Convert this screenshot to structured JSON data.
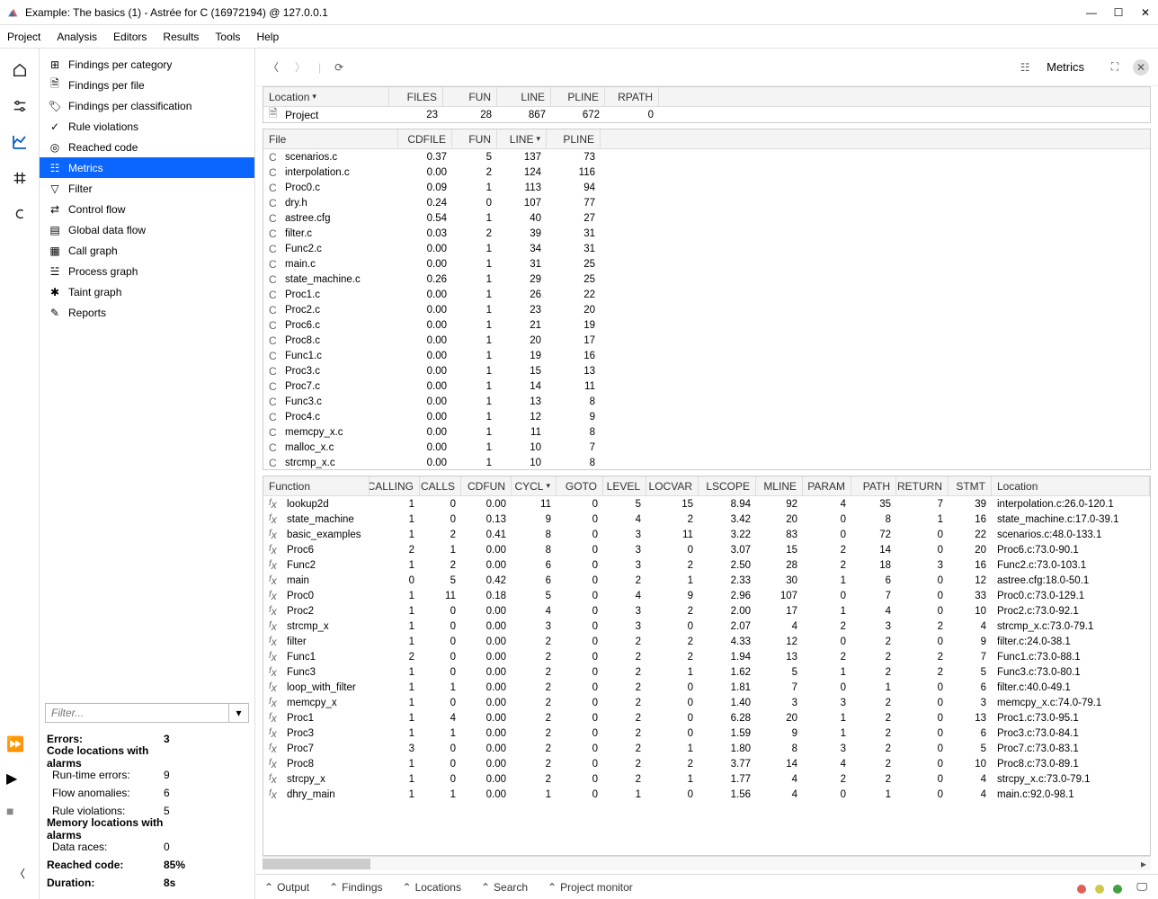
{
  "window": {
    "title": "Example: The basics (1) - Astrée for C (16972194) @ 127.0.0.1"
  },
  "menu": [
    "Project",
    "Analysis",
    "Editors",
    "Results",
    "Tools",
    "Help"
  ],
  "nav": {
    "items": [
      {
        "label": "Findings per category",
        "icon": "⊞"
      },
      {
        "label": "Findings per file",
        "icon": "🗎"
      },
      {
        "label": "Findings per classification",
        "icon": "🏷"
      },
      {
        "label": "Rule violations",
        "icon": "✓"
      },
      {
        "label": "Reached code",
        "icon": "◎"
      },
      {
        "label": "Metrics",
        "icon": "☷",
        "selected": true
      },
      {
        "label": "Filter",
        "icon": "▽"
      },
      {
        "label": "Control flow",
        "icon": "⇄"
      },
      {
        "label": "Global data flow",
        "icon": "▤"
      },
      {
        "label": "Call graph",
        "icon": "▦"
      },
      {
        "label": "Process graph",
        "icon": "☱"
      },
      {
        "label": "Taint graph",
        "icon": "✱"
      },
      {
        "label": "Reports",
        "icon": "✎"
      }
    ],
    "filter_placeholder": "Filter..."
  },
  "summary": {
    "rows": [
      {
        "label": "Errors:",
        "value": "3",
        "bold": true
      },
      {
        "label": "Code locations with alarms",
        "value": "",
        "bold": true
      },
      {
        "label": "Run-time errors:",
        "value": "9",
        "indent": true
      },
      {
        "label": "Flow anomalies:",
        "value": "6",
        "indent": true
      },
      {
        "label": "Rule violations:",
        "value": "5",
        "indent": true
      },
      {
        "label": "Memory locations with alarms",
        "value": "",
        "bold": true
      },
      {
        "label": "Data races:",
        "value": "0",
        "indent": true
      },
      {
        "label": "Reached code:",
        "value": "85%",
        "bold": true
      },
      {
        "label": "Duration:",
        "value": "8s",
        "bold": true
      }
    ]
  },
  "toolbar_right": {
    "metrics": "Metrics"
  },
  "project_table": {
    "headers": [
      "Location",
      "FILES",
      "FUN",
      "LINE",
      "PLINE",
      "RPATH"
    ],
    "rows": [
      {
        "loc": "Project",
        "files": "23",
        "fun": "28",
        "line": "867",
        "pline": "672",
        "rpath": "0"
      }
    ]
  },
  "files_table": {
    "headers": [
      "File",
      "CDFILE",
      "FUN",
      "LINE",
      "PLINE"
    ],
    "sort_col": "LINE",
    "rows": [
      {
        "f": "scenarios.c",
        "cd": "0.37",
        "fun": "5",
        "line": "137",
        "pl": "73"
      },
      {
        "f": "interpolation.c",
        "cd": "0.00",
        "fun": "2",
        "line": "124",
        "pl": "116"
      },
      {
        "f": "Proc0.c",
        "cd": "0.09",
        "fun": "1",
        "line": "113",
        "pl": "94"
      },
      {
        "f": "dry.h",
        "cd": "0.24",
        "fun": "0",
        "line": "107",
        "pl": "77"
      },
      {
        "f": "astree.cfg",
        "cd": "0.54",
        "fun": "1",
        "line": "40",
        "pl": "27"
      },
      {
        "f": "filter.c",
        "cd": "0.03",
        "fun": "2",
        "line": "39",
        "pl": "31"
      },
      {
        "f": "Func2.c",
        "cd": "0.00",
        "fun": "1",
        "line": "34",
        "pl": "31"
      },
      {
        "f": "main.c",
        "cd": "0.00",
        "fun": "1",
        "line": "31",
        "pl": "25"
      },
      {
        "f": "state_machine.c",
        "cd": "0.26",
        "fun": "1",
        "line": "29",
        "pl": "25"
      },
      {
        "f": "Proc1.c",
        "cd": "0.00",
        "fun": "1",
        "line": "26",
        "pl": "22"
      },
      {
        "f": "Proc2.c",
        "cd": "0.00",
        "fun": "1",
        "line": "23",
        "pl": "20"
      },
      {
        "f": "Proc6.c",
        "cd": "0.00",
        "fun": "1",
        "line": "21",
        "pl": "19"
      },
      {
        "f": "Proc8.c",
        "cd": "0.00",
        "fun": "1",
        "line": "20",
        "pl": "17"
      },
      {
        "f": "Func1.c",
        "cd": "0.00",
        "fun": "1",
        "line": "19",
        "pl": "16"
      },
      {
        "f": "Proc3.c",
        "cd": "0.00",
        "fun": "1",
        "line": "15",
        "pl": "13"
      },
      {
        "f": "Proc7.c",
        "cd": "0.00",
        "fun": "1",
        "line": "14",
        "pl": "11"
      },
      {
        "f": "Func3.c",
        "cd": "0.00",
        "fun": "1",
        "line": "13",
        "pl": "8"
      },
      {
        "f": "Proc4.c",
        "cd": "0.00",
        "fun": "1",
        "line": "12",
        "pl": "9"
      },
      {
        "f": "memcpy_x.c",
        "cd": "0.00",
        "fun": "1",
        "line": "11",
        "pl": "8"
      },
      {
        "f": "malloc_x.c",
        "cd": "0.00",
        "fun": "1",
        "line": "10",
        "pl": "7"
      },
      {
        "f": "strcmp_x.c",
        "cd": "0.00",
        "fun": "1",
        "line": "10",
        "pl": "8"
      }
    ]
  },
  "functions_table": {
    "headers": [
      "Function",
      "CALLING",
      "CALLS",
      "CDFUN",
      "CYCL",
      "GOTO",
      "LEVEL",
      "LOCVAR",
      "LSCOPE",
      "MLINE",
      "PARAM",
      "PATH",
      "RETURN",
      "STMT",
      "Location"
    ],
    "sort_col": "CYCL",
    "rows": [
      {
        "fn": "lookup2d",
        "calling": "1",
        "calls": "0",
        "cd": "0.00",
        "cy": "11",
        "go": "0",
        "lv": "5",
        "lvar": "15",
        "ls": "8.94",
        "ml": "92",
        "pa": "4",
        "pt": "35",
        "re": "7",
        "st": "39",
        "loc": "interpolation.c:26.0-120.1"
      },
      {
        "fn": "state_machine",
        "calling": "1",
        "calls": "0",
        "cd": "0.13",
        "cy": "9",
        "go": "0",
        "lv": "4",
        "lvar": "2",
        "ls": "3.42",
        "ml": "20",
        "pa": "0",
        "pt": "8",
        "re": "1",
        "st": "16",
        "loc": "state_machine.c:17.0-39.1"
      },
      {
        "fn": "basic_examples",
        "calling": "1",
        "calls": "2",
        "cd": "0.41",
        "cy": "8",
        "go": "0",
        "lv": "3",
        "lvar": "11",
        "ls": "3.22",
        "ml": "83",
        "pa": "0",
        "pt": "72",
        "re": "0",
        "st": "22",
        "loc": "scenarios.c:48.0-133.1"
      },
      {
        "fn": "Proc6",
        "calling": "2",
        "calls": "1",
        "cd": "0.00",
        "cy": "8",
        "go": "0",
        "lv": "3",
        "lvar": "0",
        "ls": "3.07",
        "ml": "15",
        "pa": "2",
        "pt": "14",
        "re": "0",
        "st": "20",
        "loc": "Proc6.c:73.0-90.1"
      },
      {
        "fn": "Func2",
        "calling": "1",
        "calls": "2",
        "cd": "0.00",
        "cy": "6",
        "go": "0",
        "lv": "3",
        "lvar": "2",
        "ls": "2.50",
        "ml": "28",
        "pa": "2",
        "pt": "18",
        "re": "3",
        "st": "16",
        "loc": "Func2.c:73.0-103.1"
      },
      {
        "fn": "main",
        "calling": "0",
        "calls": "5",
        "cd": "0.42",
        "cy": "6",
        "go": "0",
        "lv": "2",
        "lvar": "1",
        "ls": "2.33",
        "ml": "30",
        "pa": "1",
        "pt": "6",
        "re": "0",
        "st": "12",
        "loc": "astree.cfg:18.0-50.1"
      },
      {
        "fn": "Proc0",
        "calling": "1",
        "calls": "11",
        "cd": "0.18",
        "cy": "5",
        "go": "0",
        "lv": "4",
        "lvar": "9",
        "ls": "2.96",
        "ml": "107",
        "pa": "0",
        "pt": "7",
        "re": "0",
        "st": "33",
        "loc": "Proc0.c:73.0-129.1"
      },
      {
        "fn": "Proc2",
        "calling": "1",
        "calls": "0",
        "cd": "0.00",
        "cy": "4",
        "go": "0",
        "lv": "3",
        "lvar": "2",
        "ls": "2.00",
        "ml": "17",
        "pa": "1",
        "pt": "4",
        "re": "0",
        "st": "10",
        "loc": "Proc2.c:73.0-92.1"
      },
      {
        "fn": "strcmp_x",
        "calling": "1",
        "calls": "0",
        "cd": "0.00",
        "cy": "3",
        "go": "0",
        "lv": "3",
        "lvar": "0",
        "ls": "2.07",
        "ml": "4",
        "pa": "2",
        "pt": "3",
        "re": "2",
        "st": "4",
        "loc": "strcmp_x.c:73.0-79.1"
      },
      {
        "fn": "filter",
        "calling": "1",
        "calls": "0",
        "cd": "0.00",
        "cy": "2",
        "go": "0",
        "lv": "2",
        "lvar": "2",
        "ls": "4.33",
        "ml": "12",
        "pa": "0",
        "pt": "2",
        "re": "0",
        "st": "9",
        "loc": "filter.c:24.0-38.1"
      },
      {
        "fn": "Func1",
        "calling": "2",
        "calls": "0",
        "cd": "0.00",
        "cy": "2",
        "go": "0",
        "lv": "2",
        "lvar": "2",
        "ls": "1.94",
        "ml": "13",
        "pa": "2",
        "pt": "2",
        "re": "2",
        "st": "7",
        "loc": "Func1.c:73.0-88.1"
      },
      {
        "fn": "Func3",
        "calling": "1",
        "calls": "0",
        "cd": "0.00",
        "cy": "2",
        "go": "0",
        "lv": "2",
        "lvar": "1",
        "ls": "1.62",
        "ml": "5",
        "pa": "1",
        "pt": "2",
        "re": "2",
        "st": "5",
        "loc": "Func3.c:73.0-80.1"
      },
      {
        "fn": "loop_with_filter",
        "calling": "1",
        "calls": "1",
        "cd": "0.00",
        "cy": "2",
        "go": "0",
        "lv": "2",
        "lvar": "0",
        "ls": "1.81",
        "ml": "7",
        "pa": "0",
        "pt": "1",
        "re": "0",
        "st": "6",
        "loc": "filter.c:40.0-49.1"
      },
      {
        "fn": "memcpy_x",
        "calling": "1",
        "calls": "0",
        "cd": "0.00",
        "cy": "2",
        "go": "0",
        "lv": "2",
        "lvar": "0",
        "ls": "1.40",
        "ml": "3",
        "pa": "3",
        "pt": "2",
        "re": "0",
        "st": "3",
        "loc": "memcpy_x.c:74.0-79.1"
      },
      {
        "fn": "Proc1",
        "calling": "1",
        "calls": "4",
        "cd": "0.00",
        "cy": "2",
        "go": "0",
        "lv": "2",
        "lvar": "0",
        "ls": "6.28",
        "ml": "20",
        "pa": "1",
        "pt": "2",
        "re": "0",
        "st": "13",
        "loc": "Proc1.c:73.0-95.1"
      },
      {
        "fn": "Proc3",
        "calling": "1",
        "calls": "1",
        "cd": "0.00",
        "cy": "2",
        "go": "0",
        "lv": "2",
        "lvar": "0",
        "ls": "1.59",
        "ml": "9",
        "pa": "1",
        "pt": "2",
        "re": "0",
        "st": "6",
        "loc": "Proc3.c:73.0-84.1"
      },
      {
        "fn": "Proc7",
        "calling": "3",
        "calls": "0",
        "cd": "0.00",
        "cy": "2",
        "go": "0",
        "lv": "2",
        "lvar": "1",
        "ls": "1.80",
        "ml": "8",
        "pa": "3",
        "pt": "2",
        "re": "0",
        "st": "5",
        "loc": "Proc7.c:73.0-83.1"
      },
      {
        "fn": "Proc8",
        "calling": "1",
        "calls": "0",
        "cd": "0.00",
        "cy": "2",
        "go": "0",
        "lv": "2",
        "lvar": "2",
        "ls": "3.77",
        "ml": "14",
        "pa": "4",
        "pt": "2",
        "re": "0",
        "st": "10",
        "loc": "Proc8.c:73.0-89.1"
      },
      {
        "fn": "strcpy_x",
        "calling": "1",
        "calls": "0",
        "cd": "0.00",
        "cy": "2",
        "go": "0",
        "lv": "2",
        "lvar": "1",
        "ls": "1.77",
        "ml": "4",
        "pa": "2",
        "pt": "2",
        "re": "0",
        "st": "4",
        "loc": "strcpy_x.c:73.0-79.1"
      },
      {
        "fn": "dhry_main",
        "calling": "1",
        "calls": "1",
        "cd": "0.00",
        "cy": "1",
        "go": "0",
        "lv": "1",
        "lvar": "0",
        "ls": "1.56",
        "ml": "4",
        "pa": "0",
        "pt": "1",
        "re": "0",
        "st": "4",
        "loc": "main.c:92.0-98.1"
      }
    ]
  },
  "output_tabs": [
    "Output",
    "Findings",
    "Locations",
    "Search",
    "Project monitor"
  ],
  "status_colors": [
    "#e06055",
    "#cfc94a",
    "#3fa23f"
  ]
}
